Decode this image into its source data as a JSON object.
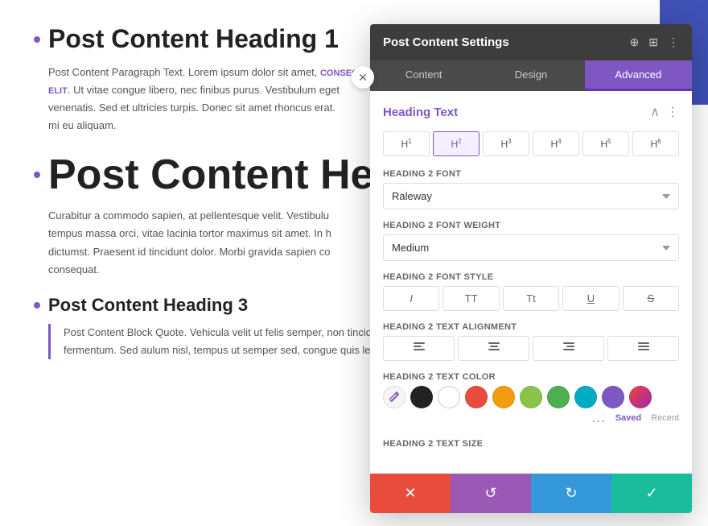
{
  "page": {
    "heading1": "Post Content Heading 1",
    "paragraph1": "Post Content Paragraph Text. Lorem ipsum dolor sit amet, consectetur adipiscing elit. Ut vitae congue libero, nec finibus purus. Vestibulum eget venenatis. Sed et ultricies turpis. Donec sit amet rhoncus erat. mi eu aliquam.",
    "link_text": "CONSECTETUR ADIPISCING ELIT",
    "heading2_partial": "Post Content Heading",
    "paragraph2": "Curabitur a commodo sapien, at pellentesque velit. Vestibulum tempus massa orci, vitae lacinia tortor maximus sit amet. In h dictumst. Praesent id tincidunt dolor. Morbi gravida sapien co consequat.",
    "heading3": "Post Content Heading 3",
    "blockquote": "Post Content Block Quote. Vehicula velit ut felis semper, non tincidunt dolor fermentum. Sed aulum nisl, tempus ut semper sed, congue quis leo. Integer nec"
  },
  "panel": {
    "title": "Post Content Settings",
    "tabs": [
      {
        "label": "Content",
        "active": false
      },
      {
        "label": "Design",
        "active": false
      },
      {
        "label": "Advanced",
        "active": true
      }
    ],
    "section_title": "Heading Text",
    "heading_tabs": [
      "H1",
      "H2",
      "H3",
      "H4",
      "H5",
      "H6"
    ],
    "active_heading": 1,
    "fields": {
      "font_label": "Heading 2 Font",
      "font_value": "Raleway",
      "weight_label": "Heading 2 Font Weight",
      "weight_value": "Medium",
      "style_label": "Heading 2 Font Style",
      "alignment_label": "Heading 2 Text Alignment",
      "color_label": "Heading 2 Text Color",
      "size_label": "Heading 2 Text Size"
    },
    "style_buttons": [
      "I",
      "TT",
      "Tt",
      "U",
      "S"
    ],
    "colors": [
      {
        "id": "eyedropper",
        "color": "transparent",
        "is_eyedropper": true
      },
      {
        "id": "black",
        "color": "#222222"
      },
      {
        "id": "white",
        "color": "#ffffff"
      },
      {
        "id": "red",
        "color": "#e74c3c"
      },
      {
        "id": "orange",
        "color": "#f39c12"
      },
      {
        "id": "yellow-green",
        "color": "#8bc34a"
      },
      {
        "id": "green",
        "color": "#4caf50"
      },
      {
        "id": "teal",
        "color": "#00acc1"
      },
      {
        "id": "purple",
        "color": "#7e57c2"
      },
      {
        "id": "gradient",
        "color": "linear-gradient(135deg,#f44336,#9c27b0)"
      }
    ],
    "saved_label": "Saved",
    "recent_label": "Recent",
    "footer": {
      "cancel_icon": "✕",
      "reset_icon": "↺",
      "redo_icon": "↻",
      "confirm_icon": "✓"
    }
  }
}
